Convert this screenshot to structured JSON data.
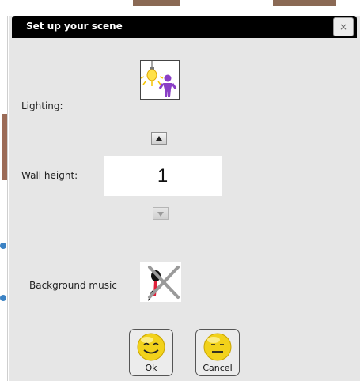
{
  "dialog": {
    "title": "Set up your scene",
    "close_label": "×"
  },
  "lighting": {
    "label": "Lighting:",
    "icon": "lightbulb-person-icon"
  },
  "wall_height": {
    "label": "Wall height:",
    "value": "1",
    "increment_icon": "arrow-up-icon",
    "decrement_icon": "arrow-down-icon"
  },
  "background_music": {
    "label": "Background music",
    "icon": "microphone-muted-icon"
  },
  "buttons": {
    "ok_label": "Ok",
    "cancel_label": "Cancel"
  },
  "colors": {
    "titlebar": "#000000",
    "dialog_bg": "#e6e6e6",
    "smiley": "#f2d21b"
  }
}
